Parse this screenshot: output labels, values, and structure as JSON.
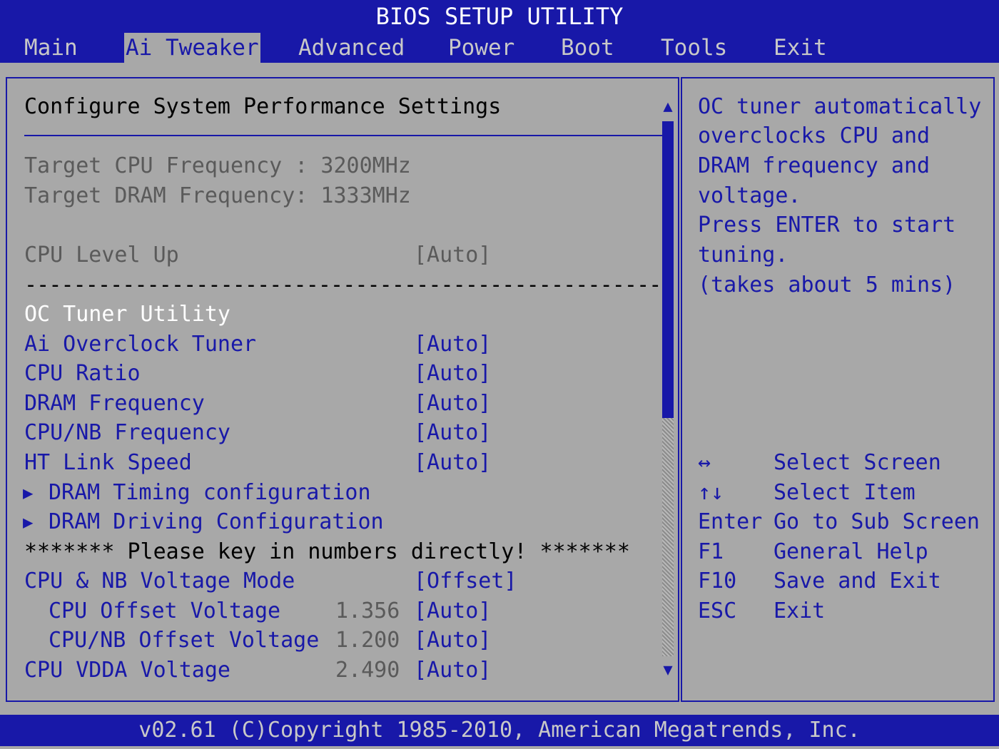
{
  "title": "BIOS SETUP UTILITY",
  "menu": [
    "Main",
    "Ai Tweaker",
    "Advanced",
    "Power",
    "Boot",
    "Tools",
    "Exit"
  ],
  "main": {
    "header": "Configure System Performance Settings",
    "target_cpu_freq": "Target CPU Frequency : 3200MHz",
    "target_dram_freq": "Target DRAM Frequency: 1333MHz",
    "cpu_level_up": {
      "label": "CPU Level Up",
      "value": "[Auto]"
    },
    "separator": "----------------------------------------------------",
    "oc_tuner": "OC Tuner Utility",
    "items": [
      {
        "label": "Ai Overclock Tuner",
        "value": "[Auto]"
      },
      {
        "label": "CPU Ratio",
        "value": "[Auto]"
      },
      {
        "label": "DRAM Frequency",
        "value": "[Auto]"
      },
      {
        "label": "CPU/NB Frequency",
        "value": "[Auto]"
      },
      {
        "label": "HT Link Speed",
        "value": "[Auto]"
      }
    ],
    "submenus": [
      "DRAM Timing configuration",
      "DRAM Driving Configuration"
    ],
    "submenu_arrow": "▶",
    "notice": "******* Please key in numbers directly! *******",
    "voltage_mode": {
      "label": "CPU & NB Voltage Mode",
      "value": "[Offset]"
    },
    "voltages": [
      {
        "label": "CPU Offset Voltage",
        "reading": "1.356",
        "value": "[Auto]"
      },
      {
        "label": "CPU/NB Offset Voltage",
        "reading": "1.200",
        "value": "[Auto]"
      },
      {
        "label": "CPU VDDA Voltage",
        "reading": "2.490",
        "value": "[Auto]"
      }
    ]
  },
  "help": {
    "lines": [
      "OC tuner automatically",
      "overclocks CPU and",
      "DRAM frequency and",
      "voltage.",
      "Press ENTER to start",
      "tuning.",
      "(takes about 5 mins)"
    ],
    "keys": [
      {
        "key": "↔",
        "desc": "Select Screen"
      },
      {
        "key": "↑↓",
        "desc": "Select Item"
      },
      {
        "key": "Enter",
        "desc": "Go to Sub Screen"
      },
      {
        "key": "F1",
        "desc": "General Help"
      },
      {
        "key": "F10",
        "desc": "Save and Exit"
      },
      {
        "key": "ESC",
        "desc": "Exit"
      }
    ]
  },
  "scroll": {
    "up": "▲",
    "down": "▼"
  },
  "status": "v02.61 (C)Copyright 1985-2010, American Megatrends, Inc.",
  "colors": {
    "background": "#a8a8a8",
    "accent": "#1818a8",
    "highlight_text": "#ffffff",
    "disabled_text": "#5a5a5a"
  }
}
